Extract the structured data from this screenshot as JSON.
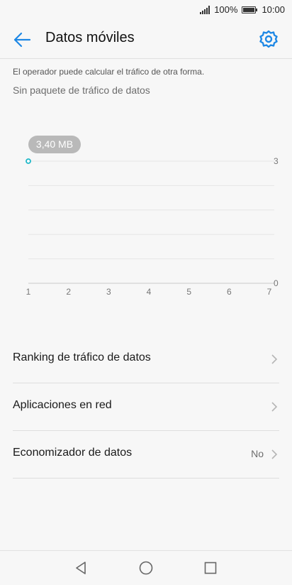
{
  "status_bar": {
    "battery_percent": "100%",
    "time": "10:00",
    "icons": [
      "signal-icon",
      "battery-icon"
    ]
  },
  "header": {
    "title": "Datos móviles",
    "back_icon": "back-arrow-icon",
    "settings_icon": "gear-icon"
  },
  "note": "El operador puede calcular el tráfico de otra forma.",
  "plan_label": "Sin paquete de tráfico de datos",
  "chart_data": {
    "type": "line",
    "x": [
      1,
      2,
      3,
      4,
      5,
      6,
      7
    ],
    "ytick_labels": [
      "0",
      "3"
    ],
    "ylim": [
      0,
      3
    ],
    "points": [
      {
        "x": 1,
        "y": 3
      }
    ],
    "annotation": "3,40 MB",
    "accent_color": "#1fb8c8"
  },
  "menu": [
    {
      "label": "Ranking de tráfico de datos",
      "value": ""
    },
    {
      "label": "Aplicaciones en red",
      "value": ""
    },
    {
      "label": "Economizador de datos",
      "value": "No"
    }
  ],
  "nav_bar": {
    "icons": [
      "back-triangle-icon",
      "home-circle-icon",
      "recents-square-icon"
    ]
  },
  "colors": {
    "accent": "#1e88e5",
    "background": "#f7f7f7"
  }
}
